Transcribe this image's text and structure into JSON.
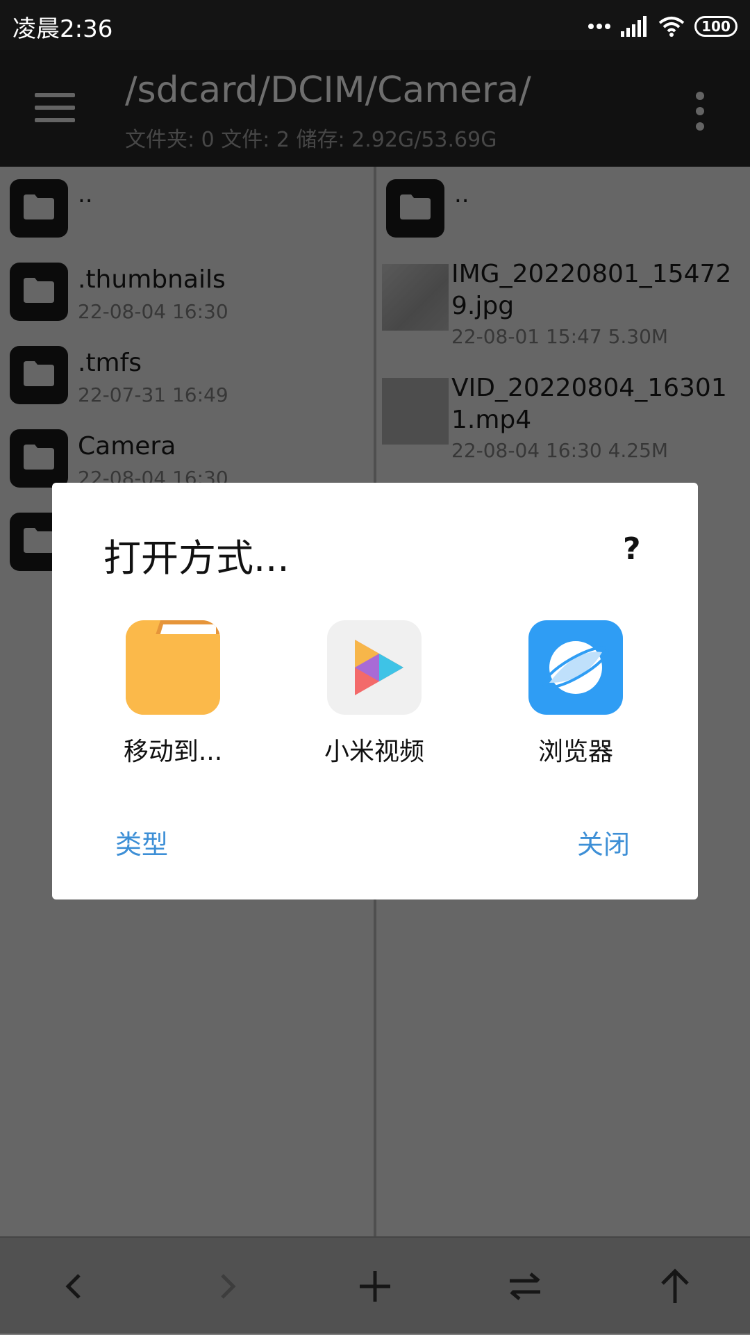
{
  "status_bar": {
    "time": "凌晨2:36",
    "battery": "100"
  },
  "toolbar": {
    "path": "/sdcard/DCIM/Camera/",
    "summary": "文件夹: 0  文件: 2  储存: 2.92G/53.69G"
  },
  "left_pane": {
    "parent": "..",
    "items": [
      {
        "name": ".thumbnails",
        "date": "22-08-04 16:30"
      },
      {
        "name": ".tmfs",
        "date": "22-07-31 16:49"
      },
      {
        "name": "Camera",
        "date": "22-08-04 16:30"
      }
    ]
  },
  "right_pane": {
    "parent": "..",
    "files": [
      {
        "name": "IMG_20220801_154729.jpg",
        "meta": "22-08-01 15:47  5.30M"
      },
      {
        "name": "VID_20220804_163011.mp4",
        "meta": "22-08-04 16:30  4.25M"
      }
    ]
  },
  "dialog": {
    "title": "打开方式...",
    "help": "?",
    "apps": [
      {
        "label": "移动到...",
        "icon": "folder-app-icon"
      },
      {
        "label": "小米视频",
        "icon": "mi-video-icon"
      },
      {
        "label": "浏览器",
        "icon": "browser-icon"
      }
    ],
    "type_button": "类型",
    "close_button": "关闭"
  },
  "colors": {
    "accent": "#3d8fd6",
    "folder_yellow": "#fbb94a",
    "browser_blue": "#2f9df4"
  }
}
